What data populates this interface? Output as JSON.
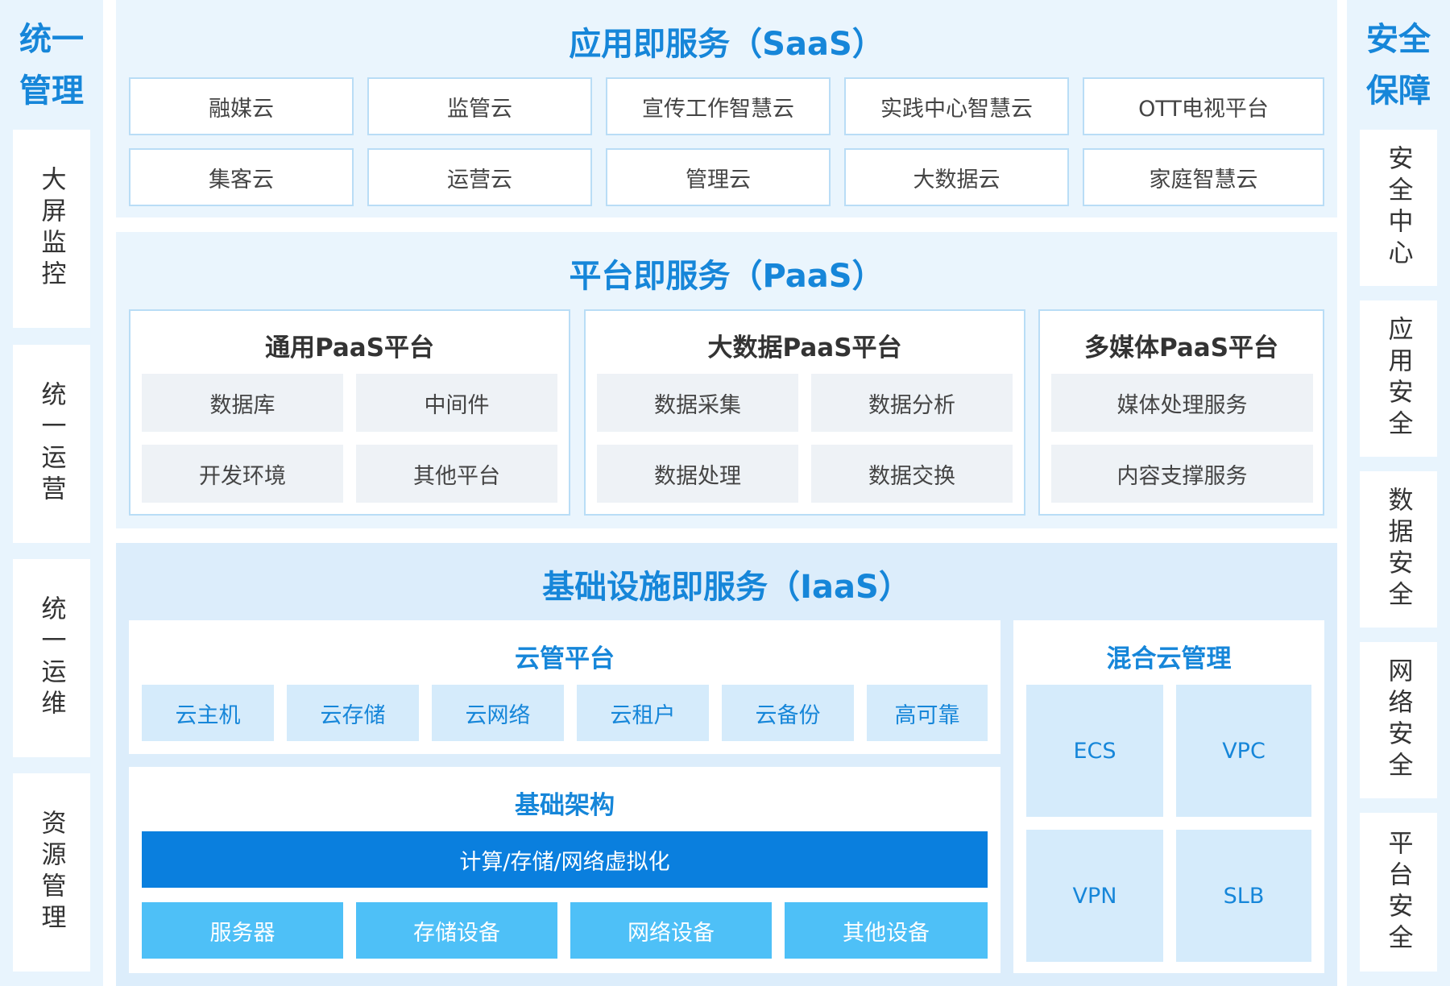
{
  "left": {
    "title": [
      "统一",
      "管理"
    ],
    "items": [
      "大屏监控",
      "统一运营",
      "统一运维",
      "资源管理"
    ]
  },
  "right": {
    "title": [
      "安全",
      "保障"
    ],
    "items": [
      "安全中心",
      "应用安全",
      "数据安全",
      "网络安全",
      "平台安全"
    ]
  },
  "saas": {
    "title": "应用即服务（SaaS）",
    "row1": [
      "融媒云",
      "监管云",
      "宣传工作智慧云",
      "实践中心智慧云",
      "OTT电视平台"
    ],
    "row2": [
      "集客云",
      "运营云",
      "管理云",
      "大数据云",
      "家庭智慧云"
    ]
  },
  "paas": {
    "title": "平台即服务（PaaS）",
    "groups": [
      {
        "title": "通用PaaS平台",
        "items": [
          "数据库",
          "中间件",
          "开发环境",
          "其他平台"
        ]
      },
      {
        "title": "大数据PaaS平台",
        "items": [
          "数据采集",
          "数据分析",
          "数据处理",
          "数据交换"
        ]
      },
      {
        "title": "多媒体PaaS平台",
        "items": [
          "媒体处理服务",
          "内容支撑服务"
        ]
      }
    ]
  },
  "iaas": {
    "title": "基础设施即服务（IaaS）",
    "cloud_mgmt": {
      "title": "云管平台",
      "items": [
        "云主机",
        "云存储",
        "云网络",
        "云租户",
        "云备份",
        "高可靠"
      ]
    },
    "infra": {
      "title": "基础架构",
      "virtualization": "计算/存储/网络虚拟化",
      "devices": [
        "服务器",
        "存储设备",
        "网络设备",
        "其他设备"
      ]
    },
    "hybrid": {
      "title": "混合云管理",
      "items": [
        "ECS",
        "VPC",
        "VPN",
        "SLB"
      ]
    }
  }
}
